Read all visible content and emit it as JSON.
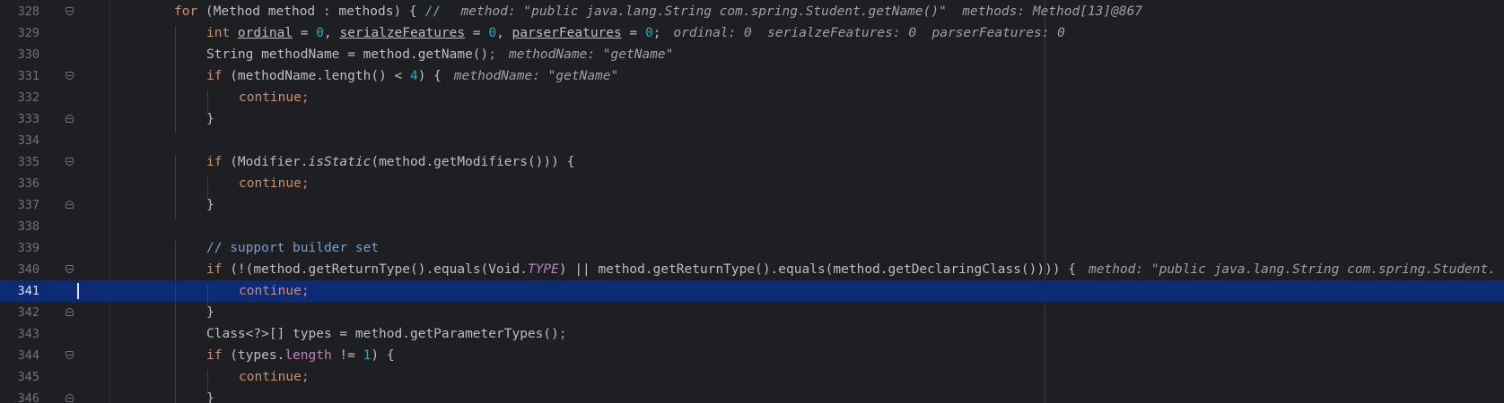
{
  "lines": [
    {
      "num": "328",
      "fold": "open",
      "indent": 1,
      "tokens": [
        {
          "t": "for",
          "c": "kw"
        },
        {
          "t": " (Method method : methods) { "
        },
        {
          "t": "// ",
          "c": "cm"
        }
      ],
      "hint": "method: \"public java.lang.String com.spring.Student.getName()\"  methods: Method[13]@867"
    },
    {
      "num": "329",
      "fold": "",
      "indent": 2,
      "tokens": [
        {
          "t": "int ",
          "c": "kw"
        },
        {
          "t": "ordinal",
          "c": "ul"
        },
        {
          "t": " = "
        },
        {
          "t": "0",
          "c": "num"
        },
        {
          "t": ", "
        },
        {
          "t": "serialzeFeatures",
          "c": "ul"
        },
        {
          "t": " = "
        },
        {
          "t": "0",
          "c": "num"
        },
        {
          "t": ", "
        },
        {
          "t": "parserFeatures",
          "c": "ul"
        },
        {
          "t": " = "
        },
        {
          "t": "0",
          "c": "num"
        },
        {
          "t": ";"
        }
      ],
      "hint": "ordinal: 0  serialzeFeatures: 0  parserFeatures: 0"
    },
    {
      "num": "330",
      "fold": "",
      "indent": 2,
      "tokens": [
        {
          "t": "String methodName = method.getName()"
        },
        {
          "t": ";",
          "c": "kw"
        }
      ],
      "hint": "methodName: \"getName\""
    },
    {
      "num": "331",
      "fold": "open",
      "indent": 2,
      "tokens": [
        {
          "t": "if",
          "c": "kw"
        },
        {
          "t": " (methodName.length() < "
        },
        {
          "t": "4",
          "c": "num"
        },
        {
          "t": ") {"
        }
      ],
      "hint": "methodName: \"getName\""
    },
    {
      "num": "332",
      "fold": "",
      "indent": 3,
      "tokens": [
        {
          "t": "continue;",
          "c": "kw"
        }
      ],
      "hint": ""
    },
    {
      "num": "333",
      "fold": "close",
      "indent": 2,
      "tokens": [
        {
          "t": "}"
        }
      ],
      "hint": ""
    },
    {
      "num": "334",
      "fold": "",
      "indent": 0,
      "tokens": [],
      "hint": ""
    },
    {
      "num": "335",
      "fold": "open",
      "indent": 2,
      "tokens": [
        {
          "t": "if",
          "c": "kw"
        },
        {
          "t": " (Modifier."
        },
        {
          "t": "isStatic",
          "c": "it"
        },
        {
          "t": "(method.getModifiers())) {"
        }
      ],
      "hint": ""
    },
    {
      "num": "336",
      "fold": "",
      "indent": 3,
      "tokens": [
        {
          "t": "continue;",
          "c": "kw"
        }
      ],
      "hint": ""
    },
    {
      "num": "337",
      "fold": "close",
      "indent": 2,
      "tokens": [
        {
          "t": "}"
        }
      ],
      "hint": ""
    },
    {
      "num": "338",
      "fold": "",
      "indent": 0,
      "tokens": [],
      "hint": ""
    },
    {
      "num": "339",
      "fold": "",
      "indent": 2,
      "tokens": [
        {
          "t": "// support builder set",
          "c": "cm"
        }
      ],
      "hint": ""
    },
    {
      "num": "340",
      "fold": "open",
      "indent": 2,
      "tokens": [
        {
          "t": "if",
          "c": "kw"
        },
        {
          "t": " (!(method.getReturnType().equals(Void."
        },
        {
          "t": "TYPE",
          "c": "fld it"
        },
        {
          "t": ") || method.getReturnType().equals(method.getDeclaringClass()))) {"
        }
      ],
      "hint": "method: \"public java.lang.String com.spring.Student."
    },
    {
      "num": "341",
      "fold": "",
      "indent": 3,
      "current": true,
      "tokens": [
        {
          "t": "continue;",
          "c": "kw"
        }
      ],
      "hint": ""
    },
    {
      "num": "342",
      "fold": "close",
      "indent": 2,
      "tokens": [
        {
          "t": "}"
        }
      ],
      "hint": ""
    },
    {
      "num": "343",
      "fold": "",
      "indent": 2,
      "tokens": [
        {
          "t": "Class<?>[] types = method.getParameterTypes()"
        },
        {
          "t": ";",
          "c": "kw"
        }
      ],
      "hint": ""
    },
    {
      "num": "344",
      "fold": "open",
      "indent": 2,
      "tokens": [
        {
          "t": "if",
          "c": "kw"
        },
        {
          "t": " (types."
        },
        {
          "t": "length",
          "c": "fld"
        },
        {
          "t": " != "
        },
        {
          "t": "1",
          "c": "num"
        },
        {
          "t": ") {"
        }
      ],
      "hint": ""
    },
    {
      "num": "345",
      "fold": "",
      "indent": 3,
      "tokens": [
        {
          "t": "continue;",
          "c": "kw"
        }
      ],
      "hint": ""
    },
    {
      "num": "346",
      "fold": "close",
      "indent": 2,
      "tokens": [
        {
          "t": "}"
        }
      ],
      "hint": ""
    }
  ]
}
